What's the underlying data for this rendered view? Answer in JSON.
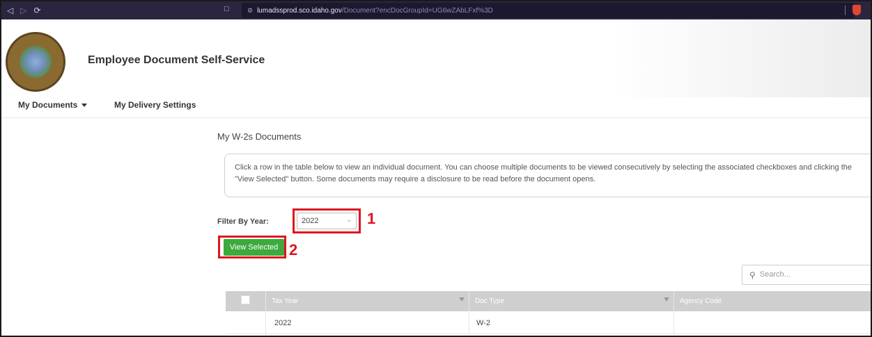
{
  "browser": {
    "url_host": "lumadssprod.sco.idaho.gov",
    "url_path": "/Document?encDocGroupId=UG6wZAbLFxf%3D"
  },
  "header": {
    "title": "Employee Document Self-Service"
  },
  "nav": {
    "my_documents": "My Documents",
    "my_delivery_settings": "My Delivery Settings"
  },
  "main": {
    "heading": "My W-2s Documents",
    "info": "Click a row in the table below to view an individual document. You can choose multiple documents to be viewed consecutively by selecting the associated checkboxes and clicking the \"View Selected\" button. Some documents may require a disclosure to be read before the document opens.",
    "filter_label": "Filter By Year:",
    "year_selected": "2022",
    "view_selected_label": "View Selected",
    "search_placeholder": "Search..."
  },
  "annotations": {
    "step1": "1",
    "step2": "2"
  },
  "table": {
    "columns": [
      "Tax Year",
      "Doc Type",
      "Agency Code"
    ],
    "rows": [
      {
        "tax_year": "2022",
        "doc_type": "W-2",
        "agency_code": ""
      }
    ]
  },
  "colors": {
    "highlight": "#e0141e",
    "button_green": "#3caa3c",
    "browser_bar": "#2b2540"
  }
}
